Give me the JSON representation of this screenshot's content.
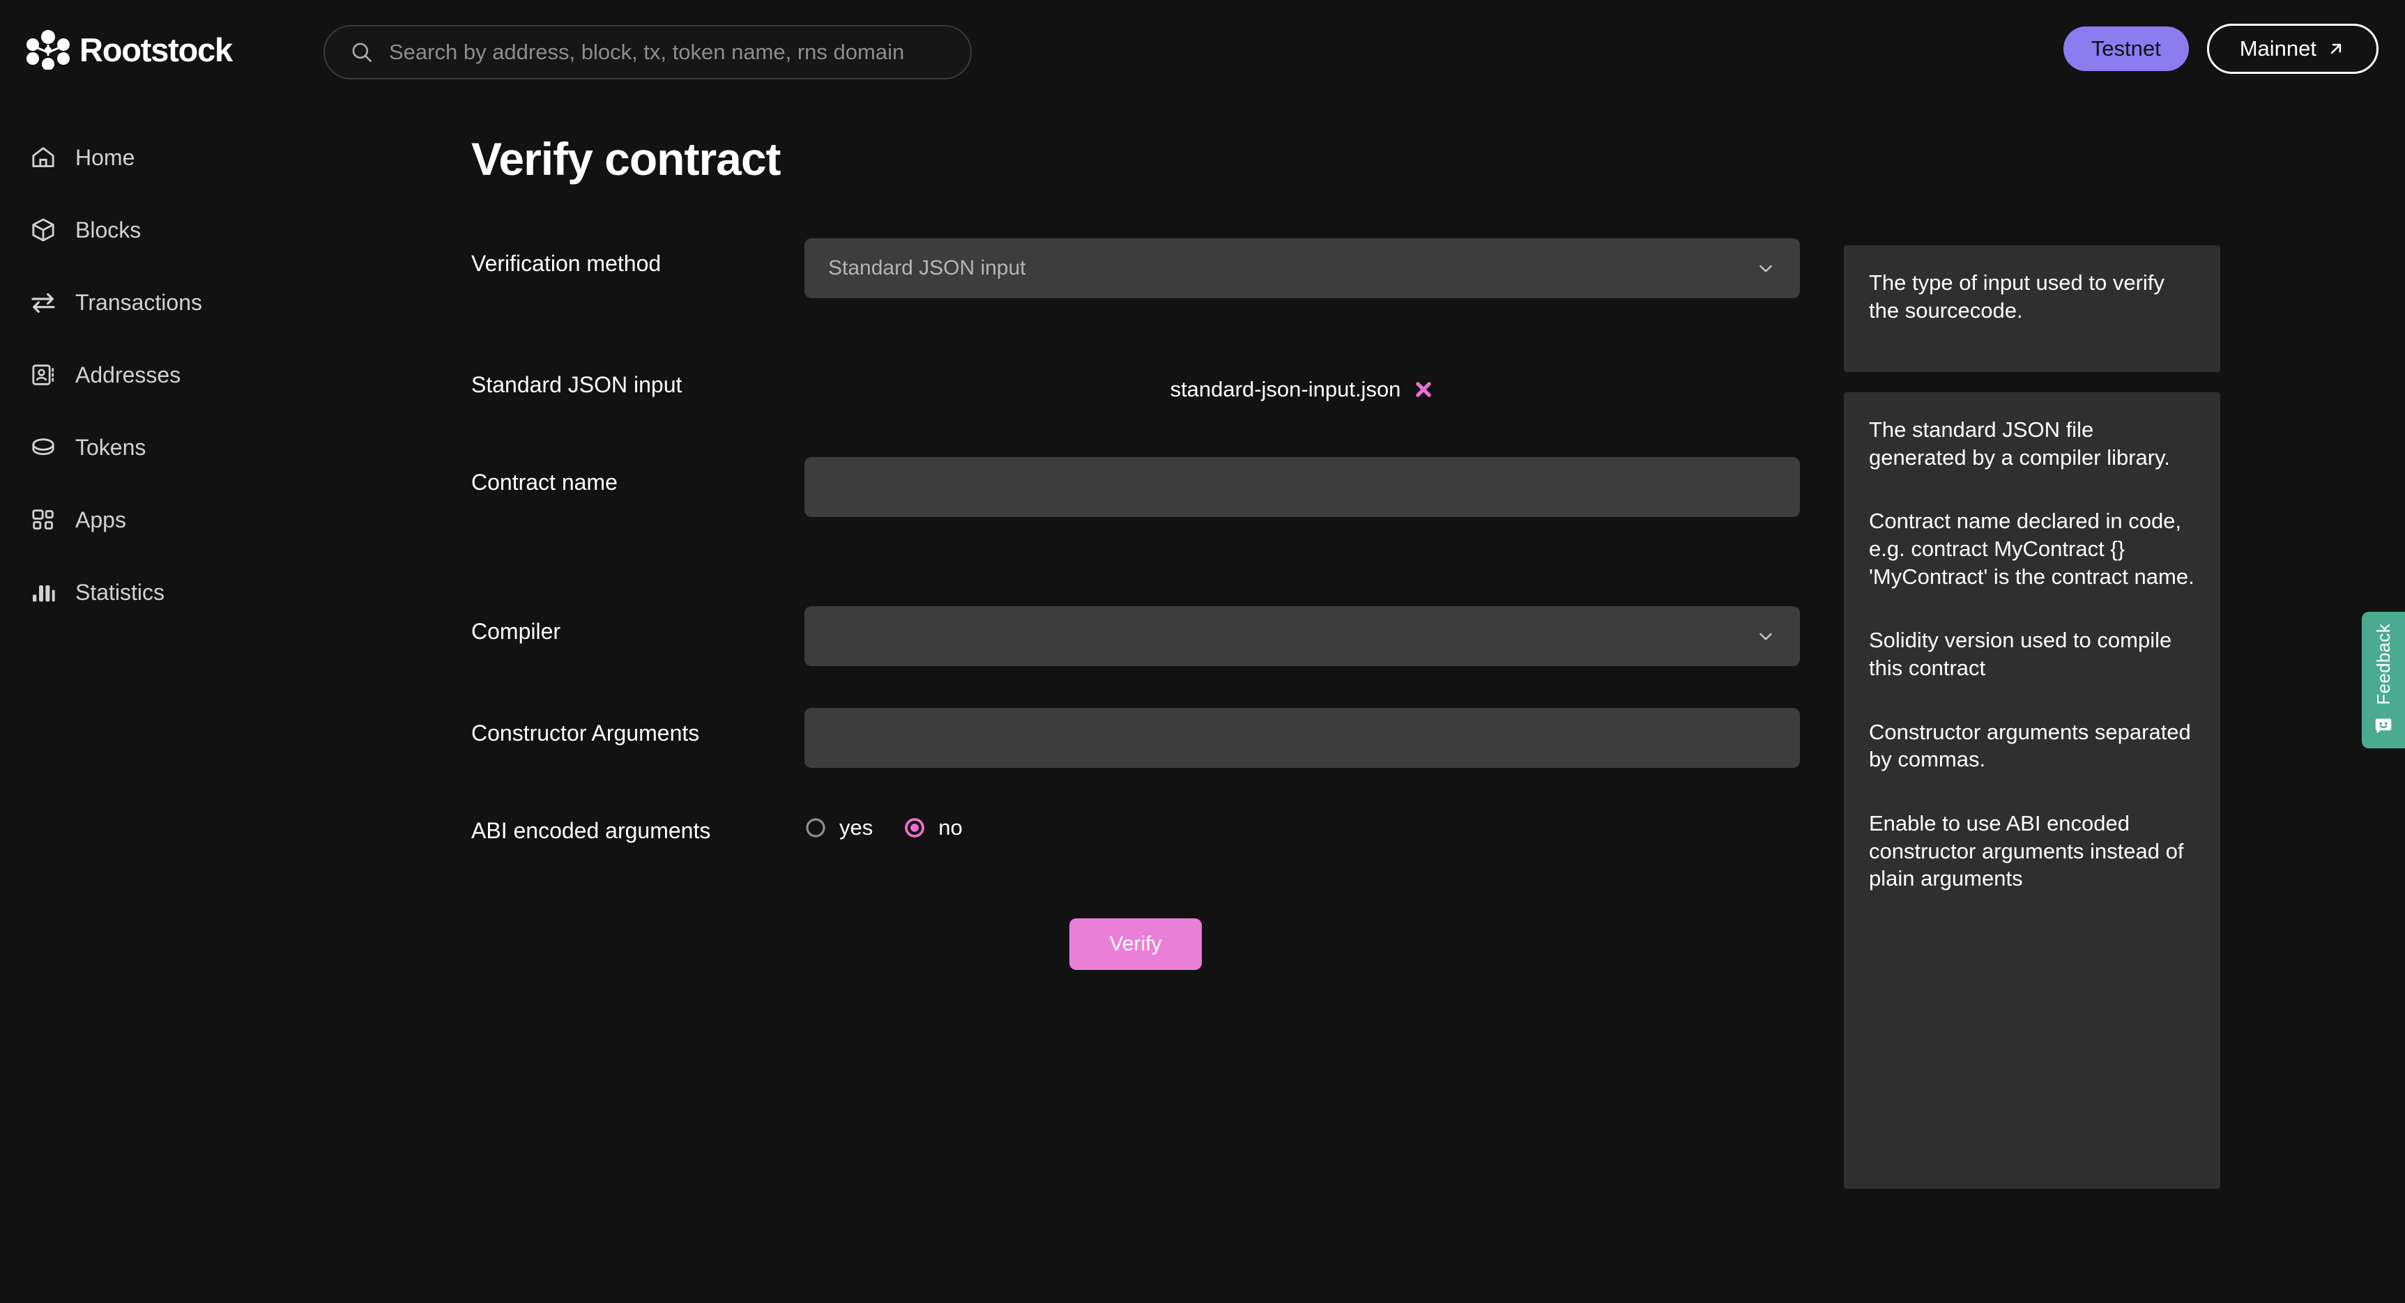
{
  "brand": {
    "name": "Rootstock",
    "logo_icon": "rootstock-logo-icon"
  },
  "search": {
    "placeholder": "Search by address, block, tx, token name, rns domain",
    "value": "",
    "icon": "search-icon"
  },
  "network": {
    "active_label": "Testnet",
    "alt_label": "Mainnet",
    "alt_icon": "external-link-arrow-icon",
    "active_color": "#8c7cf0"
  },
  "sidebar": {
    "items": [
      {
        "label": "Home",
        "icon": "home-icon"
      },
      {
        "label": "Blocks",
        "icon": "cube-icon"
      },
      {
        "label": "Transactions",
        "icon": "transactions-arrows-icon"
      },
      {
        "label": "Addresses",
        "icon": "address-book-icon"
      },
      {
        "label": "Tokens",
        "icon": "coin-icon"
      },
      {
        "label": "Apps",
        "icon": "apps-grid-icon"
      },
      {
        "label": "Statistics",
        "icon": "bar-chart-icon"
      }
    ]
  },
  "page": {
    "title": "Verify contract"
  },
  "form": {
    "verification_method": {
      "label": "Verification method",
      "value": "Standard JSON input",
      "chevron_icon": "chevron-down-icon"
    },
    "standard_json_input": {
      "label": "Standard JSON input",
      "file_name": "standard-json-input.json",
      "remove_icon": "close-x-icon",
      "remove_color": "#e86fd8"
    },
    "contract_name": {
      "label": "Contract name",
      "value": "",
      "placeholder": ""
    },
    "compiler": {
      "label": "Compiler",
      "value": "",
      "chevron_icon": "chevron-down-icon"
    },
    "constructor_arguments": {
      "label": "Constructor Arguments",
      "value": "",
      "placeholder": ""
    },
    "abi_encoded_arguments": {
      "label": "ABI encoded arguments",
      "options": [
        {
          "label": "yes",
          "selected": false
        },
        {
          "label": "no",
          "selected": true
        }
      ],
      "selected_color": "#f06fd0"
    },
    "submit": {
      "label": "Verify",
      "color": "#ea7fd8"
    }
  },
  "help": {
    "card1": {
      "text1": "The type of input used to verify the sourcecode."
    },
    "card2": {
      "text1": "The standard JSON file generated by a compiler library.",
      "text2": "Contract name declared in code, e.g. contract MyContract {} 'MyContract' is the contract name.",
      "text3": "Solidity version used to compile this contract",
      "text4": "Constructor arguments separated by commas.",
      "text5": "Enable to use ABI encoded constructor arguments instead of plain arguments"
    }
  },
  "feedback": {
    "label": "Feedback",
    "icon": "feedback-smiley-icon",
    "color": "#4aab91"
  }
}
